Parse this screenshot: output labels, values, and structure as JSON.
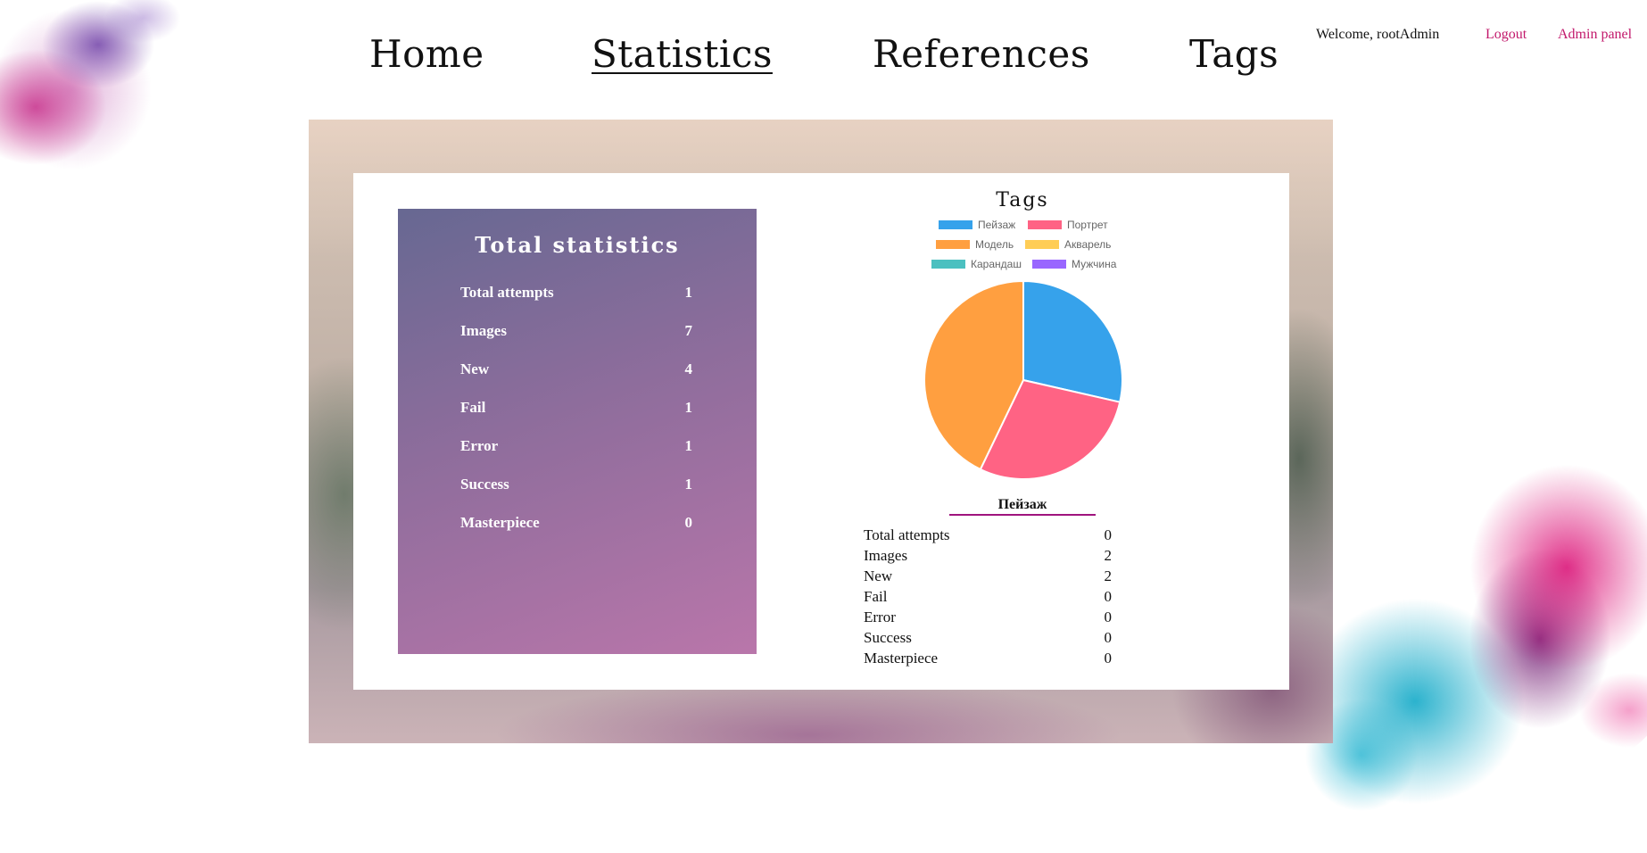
{
  "nav": {
    "home": "Home",
    "statistics": "Statistics",
    "references": "References",
    "tags": "Tags"
  },
  "user": {
    "welcome": "Welcome, rootAdmin",
    "logout": "Logout",
    "admin_panel": "Admin panel"
  },
  "total": {
    "title": "Total statistics",
    "rows": [
      {
        "label": "Total attempts",
        "value": "1"
      },
      {
        "label": "Images",
        "value": "7"
      },
      {
        "label": "New",
        "value": "4"
      },
      {
        "label": "Fail",
        "value": "1"
      },
      {
        "label": "Error",
        "value": "1"
      },
      {
        "label": "Success",
        "value": "1"
      },
      {
        "label": "Masterpiece",
        "value": "0"
      }
    ]
  },
  "chart_data": {
    "type": "pie",
    "title": "Tags",
    "legend_position": "top",
    "series": [
      {
        "name": "Пейзаж",
        "value": 2,
        "color": "#36a2eb"
      },
      {
        "name": "Портрет",
        "value": 2,
        "color": "#ff6384"
      },
      {
        "name": "Модель",
        "value": 3,
        "color": "#ff9f40"
      },
      {
        "name": "Акварель",
        "value": 0,
        "color": "#ffcd56"
      },
      {
        "name": "Карандаш",
        "value": 0,
        "color": "#4bc0c0"
      },
      {
        "name": "Мужчина",
        "value": 0,
        "color": "#9966ff"
      }
    ]
  },
  "selected_tag": {
    "name": "Пейзаж",
    "rows": [
      {
        "label": "Total attempts",
        "value": "0"
      },
      {
        "label": "Images",
        "value": "2"
      },
      {
        "label": "New",
        "value": "2"
      },
      {
        "label": "Fail",
        "value": "0"
      },
      {
        "label": "Error",
        "value": "0"
      },
      {
        "label": "Success",
        "value": "0"
      },
      {
        "label": "Masterpiece",
        "value": "0"
      }
    ]
  }
}
